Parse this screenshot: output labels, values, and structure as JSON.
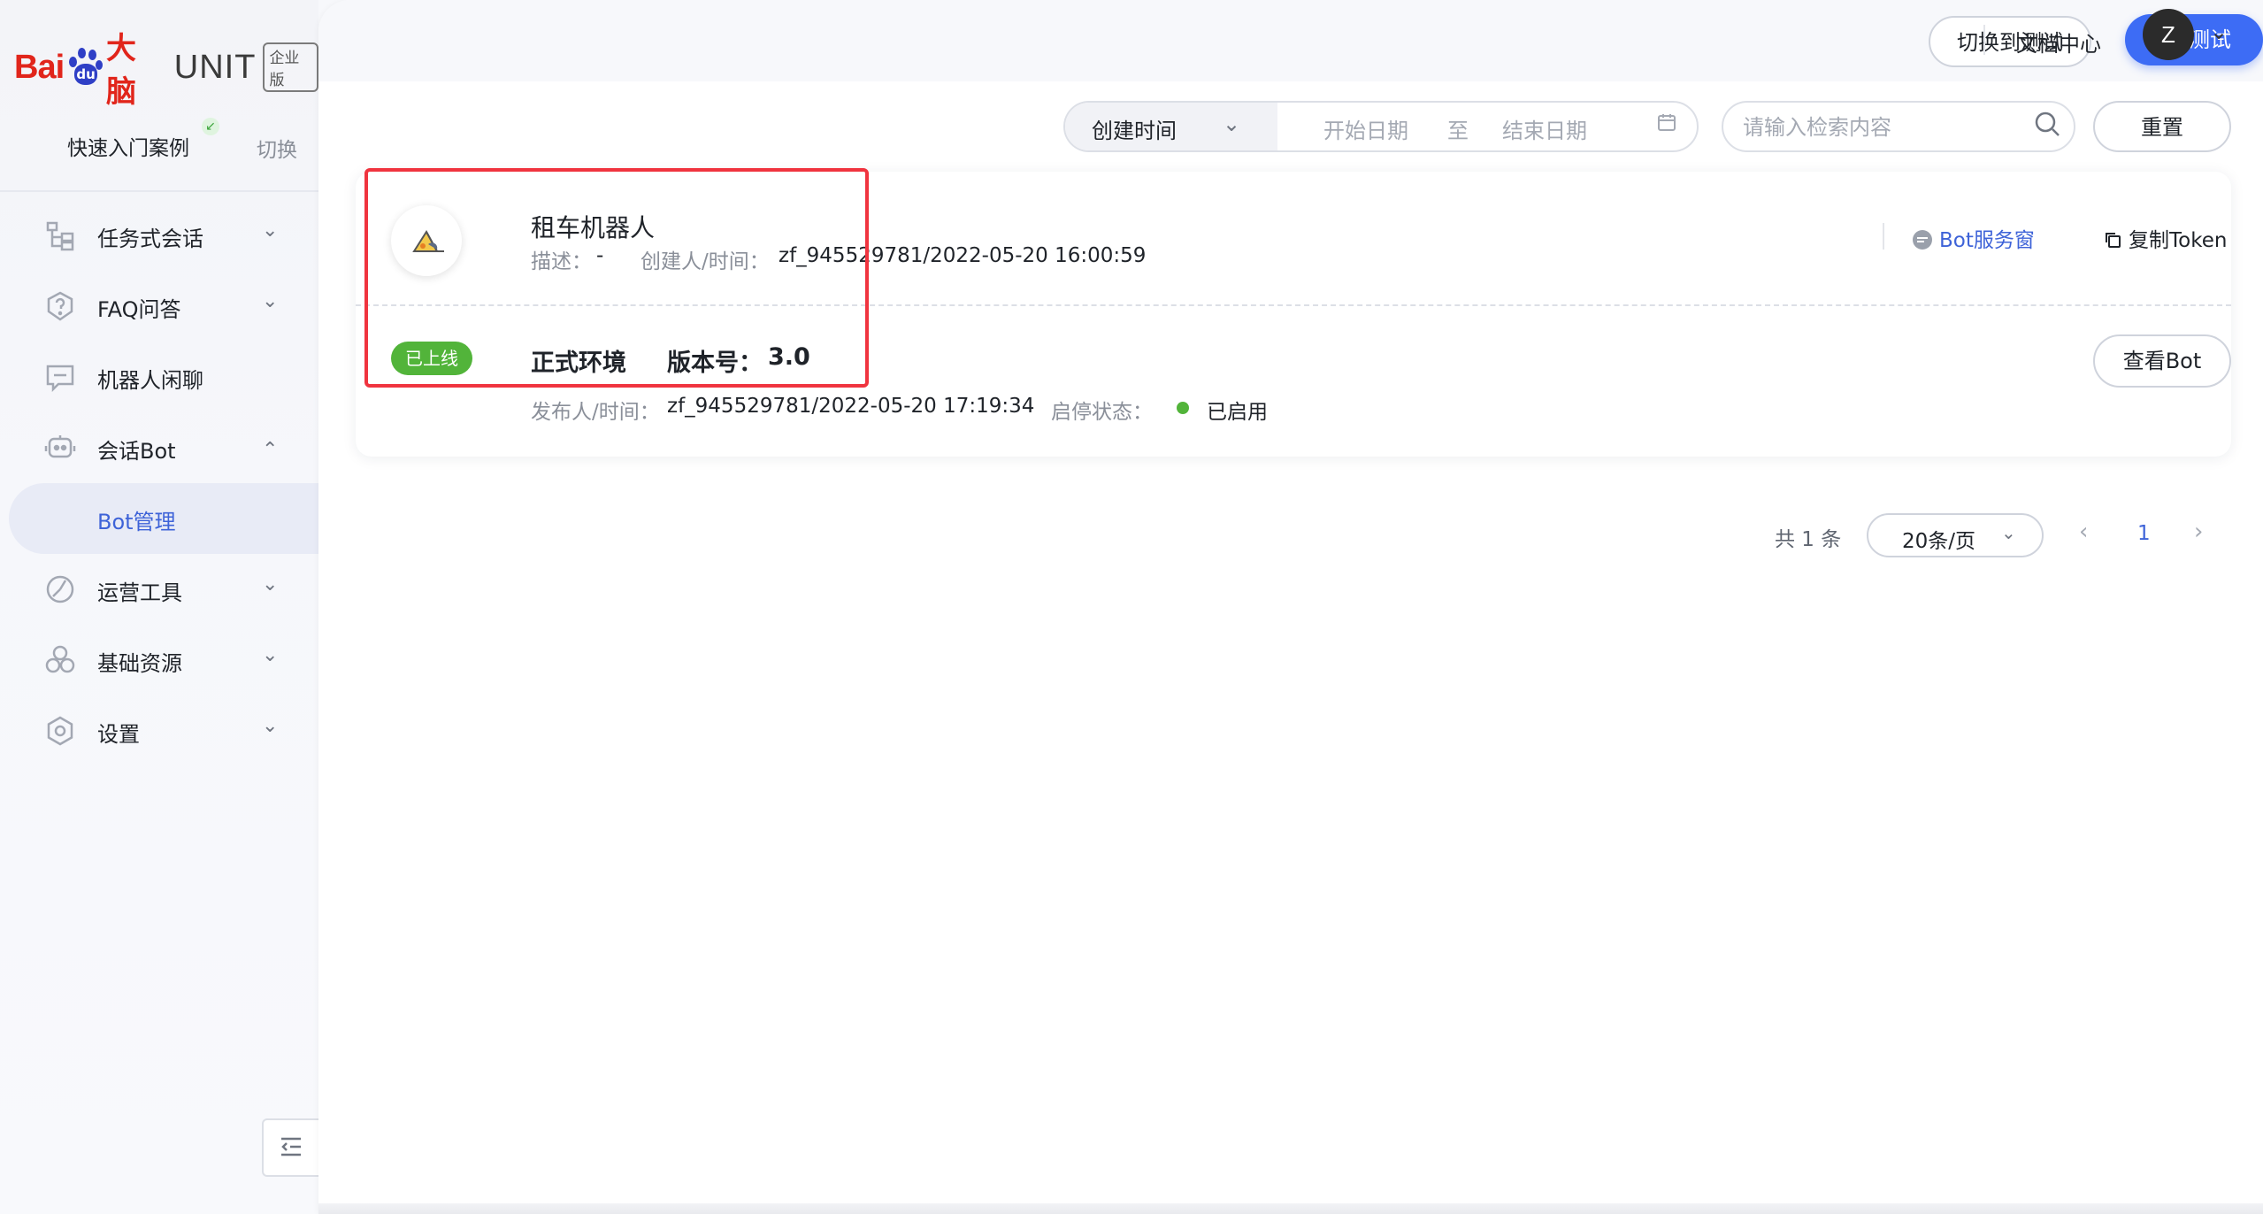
{
  "brand": {
    "bai": "Bai",
    "du": "du",
    "danao": "大脑",
    "unit": "UNIT",
    "edition": "企业版"
  },
  "sidebar": {
    "quick_start": "快速入门案例",
    "switch": "切换",
    "items": [
      {
        "label": "任务式会话",
        "icon": "task-tree-icon",
        "expanded": false
      },
      {
        "label": "FAQ问答",
        "icon": "question-shield-icon",
        "expanded": false
      },
      {
        "label": "机器人闲聊",
        "icon": "chat-bubble-icon",
        "expanded": null
      },
      {
        "label": "会话Bot",
        "icon": "robot-icon",
        "expanded": true
      },
      {
        "label": "Bot管理",
        "icon": "",
        "active": true
      },
      {
        "label": "运营工具",
        "icon": "tools-icon",
        "expanded": false
      },
      {
        "label": "基础资源",
        "icon": "resources-icon",
        "expanded": false
      },
      {
        "label": "设置",
        "icon": "settings-gear-icon",
        "expanded": false
      }
    ]
  },
  "header": {
    "switch_test": "切换到测试",
    "test": "测试",
    "docs": "文档中心",
    "avatar_letter": "Z"
  },
  "filter": {
    "sort_field": "创建时间",
    "start_placeholder": "开始日期",
    "to": "至",
    "end_placeholder": "结束日期",
    "search_placeholder": "请输入检索内容",
    "reset": "重置"
  },
  "bot": {
    "name": "租车机器人",
    "desc_label": "描述：",
    "desc_value": "-",
    "creator_label": "创建人/时间：",
    "creator_value": "zf_945529781/2022-05-20 16:00:59",
    "service_window": "Bot服务窗",
    "copy_token": "复制Token",
    "status_tag": "已上线",
    "env": "正式环境",
    "version_label": "版本号：",
    "version_value": "3.0",
    "publisher_label": "发布人/时间：",
    "publisher_value": "zf_945529781/2022-05-20 17:19:34",
    "state_label": "启停状态：",
    "state_value": "已启用",
    "view_button": "查看Bot"
  },
  "pagination": {
    "total": "共 1 条",
    "page_size": "20条/页",
    "current_page": "1"
  },
  "colors": {
    "primary": "#3d6cf5",
    "success": "#52b43a",
    "highlight": "#f0343f",
    "brand_red": "#e1251b",
    "brand_blue": "#2f3fc6"
  }
}
